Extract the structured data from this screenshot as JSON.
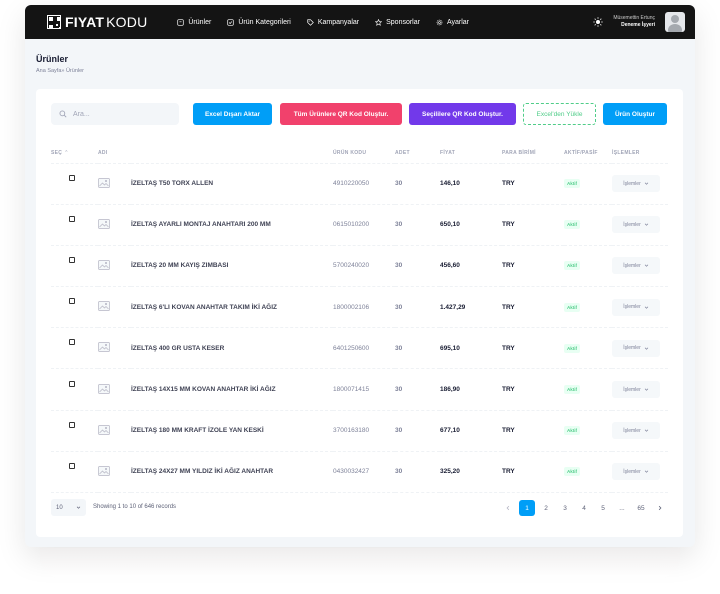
{
  "brand": {
    "bold": "FIYAT",
    "light": "KODU"
  },
  "nav": [
    {
      "label": "Ürünler",
      "icon": "box-icon"
    },
    {
      "label": "Ürün Kategorileri",
      "icon": "category-icon"
    },
    {
      "label": "Kampanyalar",
      "icon": "tag-icon"
    },
    {
      "label": "Sponsorlar",
      "icon": "star-icon"
    },
    {
      "label": "Ayarlar",
      "icon": "gear-icon"
    }
  ],
  "user": {
    "name": "Müsemettin Ertunç",
    "role": "Deneme İşyeri"
  },
  "page": {
    "title": "Ürünler",
    "breadcrumb": "Ana Sayfa»  Ürünler"
  },
  "search": {
    "placeholder": "Ara..."
  },
  "toolbar": {
    "excel_export": "Excel Dışarı Aktar",
    "all_qr": "Tüm Ürünlere QR Kod Oluştur.",
    "selected_qr": "Seçililere QR Kod Oluştur.",
    "excel_upload": "Excel'den Yükle",
    "create": "Ürün Oluştur"
  },
  "table": {
    "headers": {
      "select": "SEÇ",
      "name": "ADI",
      "code": "ÜRÜN KODU",
      "qty": "ADET",
      "price": "FİYAT",
      "currency": "PARA BİRİMİ",
      "status": "AKTİF/PASİF",
      "actions": "İŞLEMLER"
    },
    "rows": [
      {
        "name": "İZELTAŞ T50 TORX ALLEN",
        "code": "4910220050",
        "qty": "30",
        "price": "146,10",
        "currency": "TRY",
        "status": "Aktif",
        "actions": "İşlemler"
      },
      {
        "name": "İZELTAŞ AYARLI MONTAJ ANAHTARI 200 MM",
        "code": "0615010200",
        "qty": "30",
        "price": "650,10",
        "currency": "TRY",
        "status": "Aktif",
        "actions": "İşlemler"
      },
      {
        "name": "İZELTAŞ 20 MM KAYIŞ ZIMBASI",
        "code": "5700240020",
        "qty": "30",
        "price": "456,60",
        "currency": "TRY",
        "status": "Aktif",
        "actions": "İşlemler"
      },
      {
        "name": "İZELTAŞ 6'LI KOVAN ANAHTAR TAKIM İKİ AĞIZ",
        "code": "1800002106",
        "qty": "30",
        "price": "1.427,29",
        "currency": "TRY",
        "status": "Aktif",
        "actions": "İşlemler"
      },
      {
        "name": "İZELTAŞ 400 GR USTA KESER",
        "code": "6401250600",
        "qty": "30",
        "price": "695,10",
        "currency": "TRY",
        "status": "Aktif",
        "actions": "İşlemler"
      },
      {
        "name": "İZELTAŞ 14X15 MM KOVAN ANAHTAR İKİ AĞIZ",
        "code": "1800071415",
        "qty": "30",
        "price": "186,90",
        "currency": "TRY",
        "status": "Aktif",
        "actions": "İşlemler"
      },
      {
        "name": "İZELTAŞ 180 MM KRAFT İZOLE YAN KESKİ",
        "code": "3700163180",
        "qty": "30",
        "price": "677,10",
        "currency": "TRY",
        "status": "Aktif",
        "actions": "İşlemler"
      },
      {
        "name": "İZELTAŞ 24X27 MM YILDIZ İKİ AĞIZ ANAHTAR",
        "code": "0430032427",
        "qty": "30",
        "price": "325,20",
        "currency": "TRY",
        "status": "Aktif",
        "actions": "İşlemler"
      }
    ]
  },
  "footer": {
    "page_size": "10",
    "info": "Showing 1 to 10 of 646 records",
    "pages": [
      "1",
      "2",
      "3",
      "4",
      "5",
      "...",
      "65"
    ],
    "active_page": "1"
  },
  "colors": {
    "primary": "#009ef7",
    "danger": "#f1416c",
    "purple": "#7239ea",
    "success": "#50cd89",
    "navbar": "#141414"
  }
}
